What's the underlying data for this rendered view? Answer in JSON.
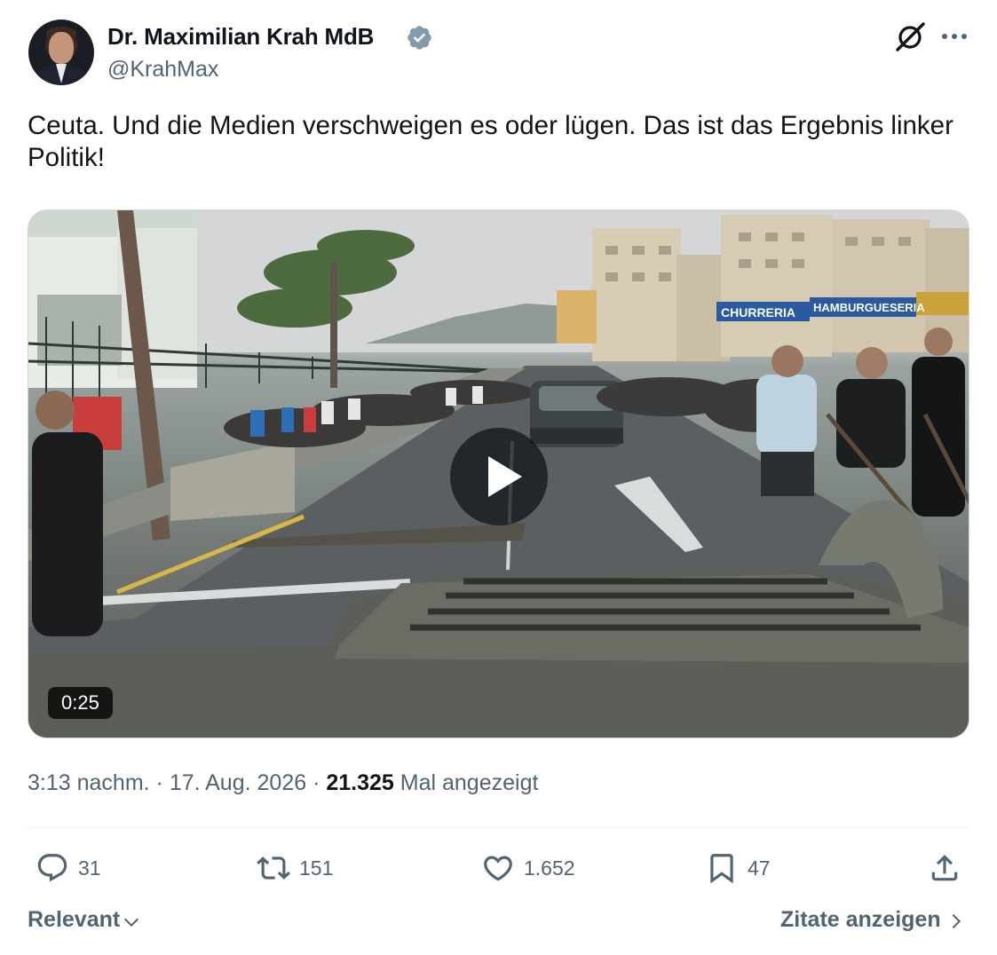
{
  "author": {
    "name": "Dr. Maximilian Krah MdB",
    "handle": "@KrahMax",
    "verified": true,
    "avatar_icon": "profile-photo"
  },
  "header_icons": [
    "grok-icon",
    "more-icon"
  ],
  "tweet": {
    "text": "Ceuta. Und die Medien verschweigen es oder lügen. Das ist das Ergebnis linker Politik!"
  },
  "media": {
    "type": "video",
    "duration": "0:25",
    "signs": [
      "CHURRERIA",
      "HAMBURGUESERIA"
    ]
  },
  "meta": {
    "time": "3:13 nachm.",
    "separator": " · ",
    "date": "17. Aug. 2026",
    "views": "21.325",
    "views_label": "Mal angezeigt"
  },
  "actions": {
    "replies": "31",
    "reposts": "151",
    "likes": "1.652",
    "bookmarks": "47"
  },
  "footer": {
    "sort_label": "Relevant",
    "quotes_label": "Zitate anzeigen"
  },
  "colors": {
    "text_primary": "#0f1419",
    "text_secondary": "#536471",
    "verified_badge": "#829aab",
    "divider": "#eff3f4"
  }
}
